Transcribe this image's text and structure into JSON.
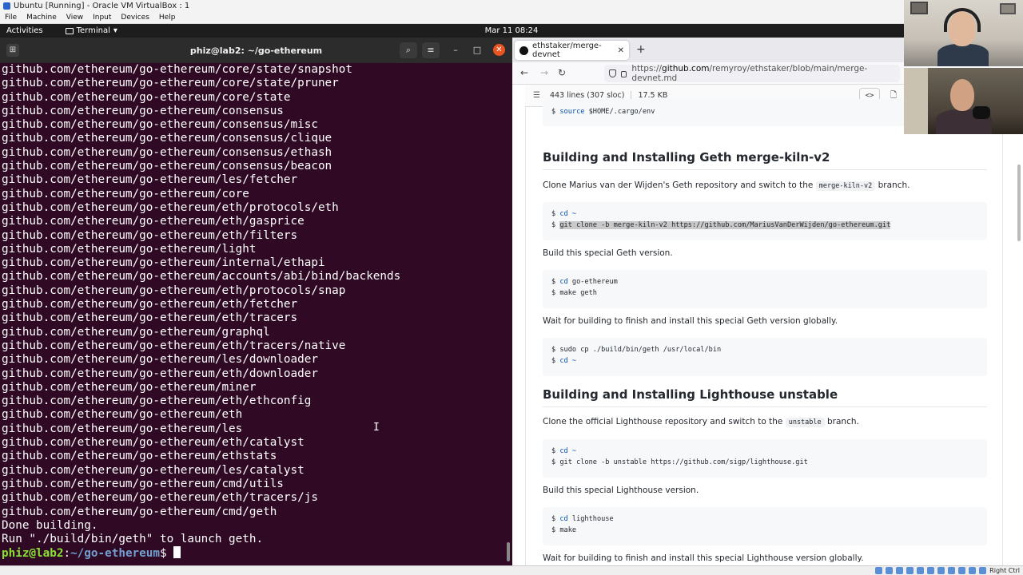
{
  "vbox": {
    "title": "Ubuntu [Running] - Oracle VM VirtualBox : 1",
    "menu": [
      "File",
      "Machine",
      "View",
      "Input",
      "Devices",
      "Help"
    ],
    "host_key": "Right Ctrl"
  },
  "topbar": {
    "activities": "Activities",
    "app_menu": "Terminal",
    "clock": "Mar 11  08:24"
  },
  "terminal": {
    "title": "phiz@lab2: ~/go-ethereum",
    "lines": [
      "github.com/ethereum/go-ethereum/core/state/snapshot",
      "github.com/ethereum/go-ethereum/core/state/pruner",
      "github.com/ethereum/go-ethereum/core/state",
      "github.com/ethereum/go-ethereum/consensus",
      "github.com/ethereum/go-ethereum/consensus/misc",
      "github.com/ethereum/go-ethereum/consensus/clique",
      "github.com/ethereum/go-ethereum/consensus/ethash",
      "github.com/ethereum/go-ethereum/consensus/beacon",
      "github.com/ethereum/go-ethereum/les/fetcher",
      "github.com/ethereum/go-ethereum/core",
      "github.com/ethereum/go-ethereum/eth/protocols/eth",
      "github.com/ethereum/go-ethereum/eth/gasprice",
      "github.com/ethereum/go-ethereum/eth/filters",
      "github.com/ethereum/go-ethereum/light",
      "github.com/ethereum/go-ethereum/internal/ethapi",
      "github.com/ethereum/go-ethereum/accounts/abi/bind/backends",
      "github.com/ethereum/go-ethereum/eth/protocols/snap",
      "github.com/ethereum/go-ethereum/eth/fetcher",
      "github.com/ethereum/go-ethereum/eth/tracers",
      "github.com/ethereum/go-ethereum/graphql",
      "github.com/ethereum/go-ethereum/eth/tracers/native",
      "github.com/ethereum/go-ethereum/les/downloader",
      "github.com/ethereum/go-ethereum/eth/downloader",
      "github.com/ethereum/go-ethereum/miner",
      "github.com/ethereum/go-ethereum/eth/ethconfig",
      "github.com/ethereum/go-ethereum/eth",
      "github.com/ethereum/go-ethereum/les",
      "github.com/ethereum/go-ethereum/eth/catalyst",
      "github.com/ethereum/go-ethereum/ethstats",
      "github.com/ethereum/go-ethereum/les/catalyst",
      "github.com/ethereum/go-ethereum/cmd/utils",
      "github.com/ethereum/go-ethereum/eth/tracers/js",
      "github.com/ethereum/go-ethereum/cmd/geth",
      "Done building.",
      "Run \"./build/bin/geth\" to launch geth."
    ],
    "prompt_user": "phiz@lab2",
    "prompt_sep": ":",
    "prompt_path": "~/go-ethereum",
    "prompt_end": "$ "
  },
  "browser": {
    "tab_title": "ethstaker/merge-devnet",
    "url_prefix": "https://",
    "url_host": "github.com",
    "url_path": "/remyroy/ethstaker/blob/main/merge-devnet.md",
    "file_lines": "443 lines (307 sloc)",
    "file_size": "17.5 KB"
  },
  "doc": {
    "code0": {
      "cmd": "source",
      "rest": " $HOME/.cargo/env"
    },
    "h_geth": "Building and Installing Geth merge-kiln-v2",
    "p_clone_geth_a": "Clone Marius van der Wijden's Geth repository and switch to the",
    "p_clone_geth_code": "merge-kiln-v2",
    "p_clone_geth_b": "branch.",
    "code1_l1_cmd": "cd",
    "code1_l1_rest": " ~",
    "code1_l2": "git clone -b merge-kiln-v2 https://github.com/MariusVanDerWijden/go-ethereum.git",
    "p_build_geth": "Build this special Geth version.",
    "code2_l1_cmd": "cd",
    "code2_l1_rest": " go-ethereum",
    "code2_l2": "make geth",
    "p_wait_geth": "Wait for building to finish and install this special Geth version globally.",
    "code3_l1": "sudo cp ./build/bin/geth /usr/local/bin",
    "code3_l2_cmd": "cd",
    "code3_l2_rest": " ~",
    "h_lighthouse": "Building and Installing Lighthouse unstable",
    "p_clone_lh_a": "Clone the official Lighthouse repository and switch to the",
    "p_clone_lh_code": "unstable",
    "p_clone_lh_b": "branch.",
    "code4_l1_cmd": "cd",
    "code4_l1_rest": " ~",
    "code4_l2": "git clone -b unstable https://github.com/sigp/lighthouse.git",
    "p_build_lh": "Build this special Lighthouse version.",
    "code5_l1_cmd": "cd",
    "code5_l1_rest": " lighthouse",
    "code5_l2": "make",
    "p_wait_lh": "Wait for building to finish and install this special Lighthouse version globally."
  },
  "icons": {
    "new_tab": "+",
    "close_tab": "✕",
    "back": "←",
    "forward": "→",
    "reload": "↻",
    "list": "☰",
    "code": "<>",
    "raw": "🗋",
    "search": "⌕",
    "hamburger": "≡",
    "minimize": "–",
    "maximize": "□",
    "close": "✕",
    "new_term_tab": "⊞",
    "dropdown": "▾",
    "prompt": "$"
  },
  "colors": {
    "terminal_bg": "#300a24",
    "prompt_user": "#8ae234",
    "prompt_path": "#729fcf",
    "close_button": "#e95420"
  }
}
